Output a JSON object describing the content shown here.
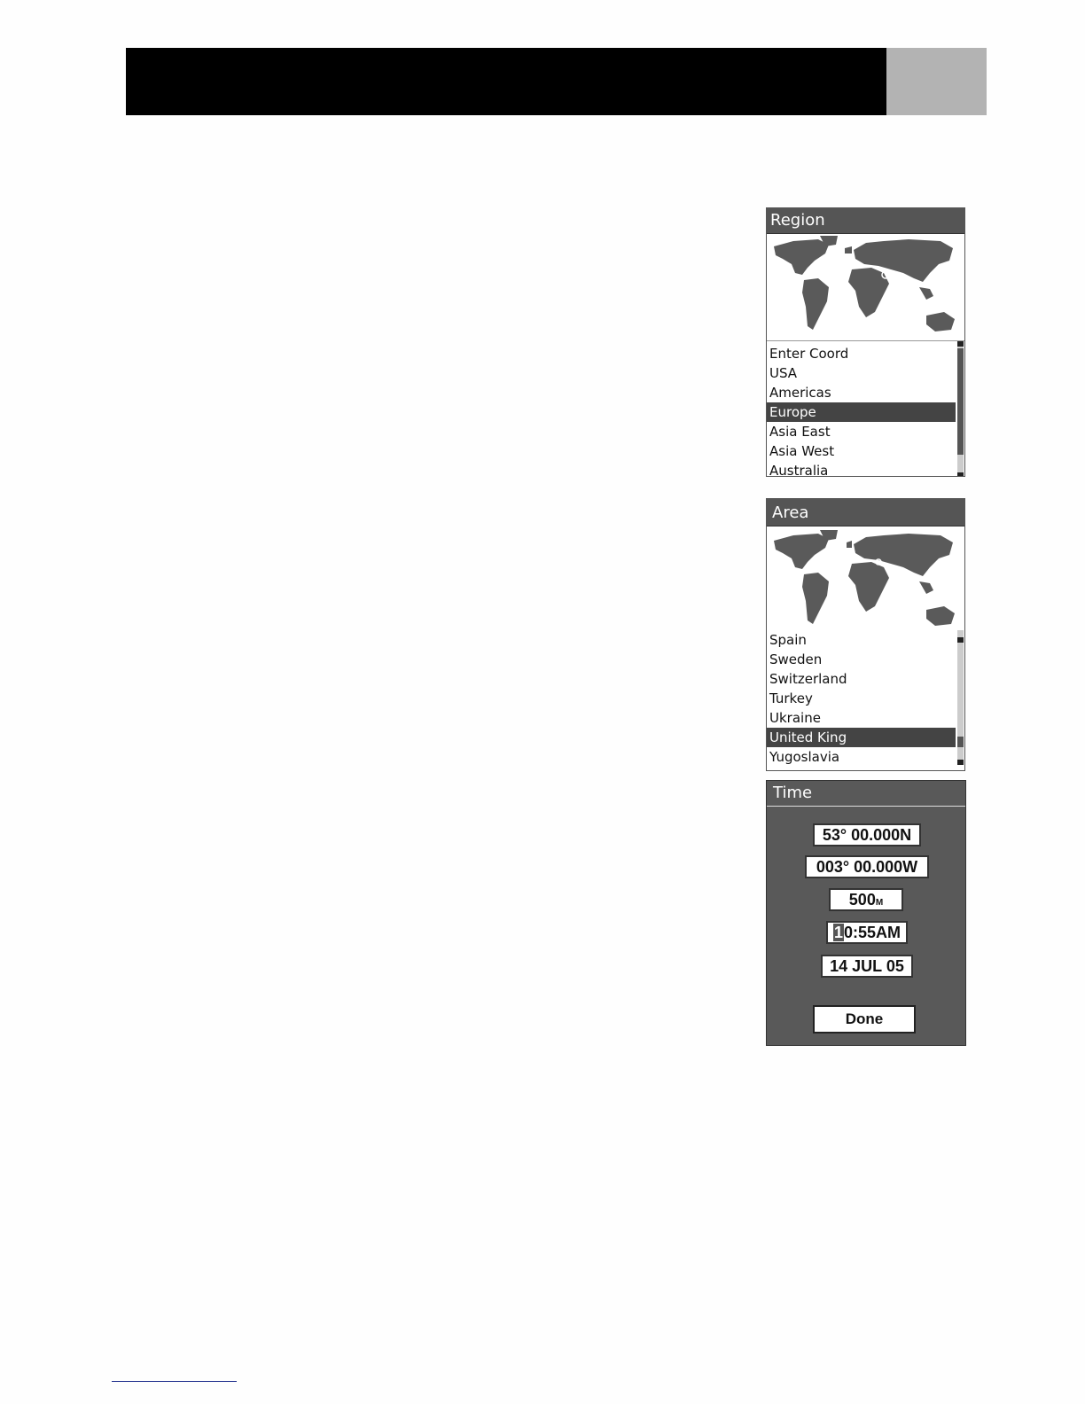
{
  "region_screen": {
    "title": "Region",
    "items": [
      "Enter Coord",
      "USA",
      "Americas",
      "Europe",
      "Asia East",
      "Asia West",
      "Australia"
    ],
    "selected": "Europe"
  },
  "area_screen": {
    "title": "Area",
    "items": [
      "Spain",
      "Sweden",
      "Switzerland",
      "Turkey",
      "Ukraine",
      "United King",
      "Yugoslavia"
    ],
    "selected": "United King"
  },
  "time_screen": {
    "title": "Time",
    "latitude": "53° 00.000N",
    "longitude": "003° 00.000W",
    "elevation_value": "500",
    "elevation_unit": "M",
    "time_cursor_char": "1",
    "time_rest": "0:55AM",
    "date": "14 JUL 05",
    "done_label": "Done"
  },
  "colors": {
    "header": "#000000",
    "header_tab": "#b3b3b3",
    "panel": "#595959",
    "selection": "#444444"
  },
  "icons": [
    "world-map-icon",
    "scroll-up-arrow-icon",
    "scroll-down-arrow-icon"
  ]
}
